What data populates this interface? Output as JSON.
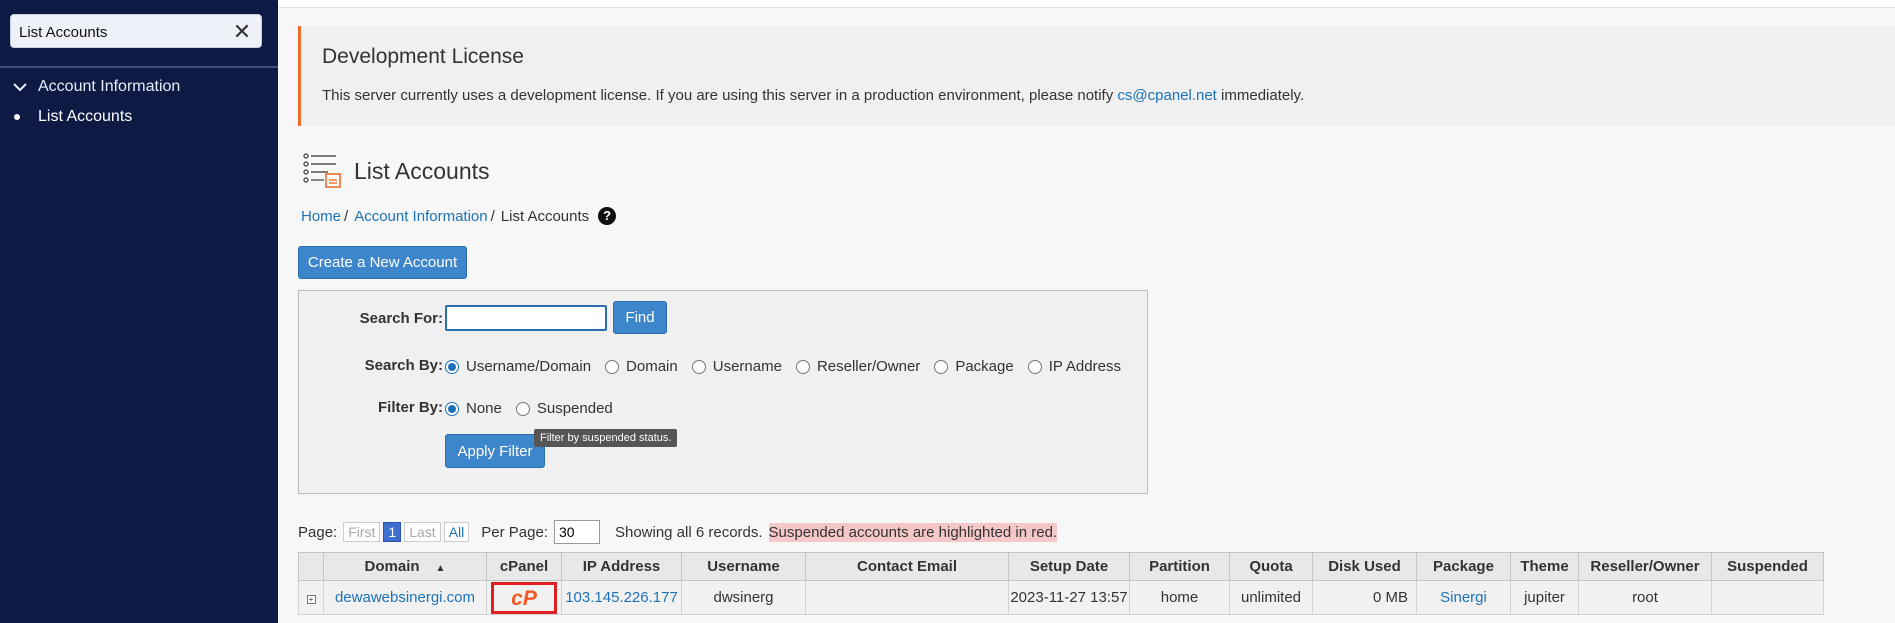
{
  "sidebar": {
    "search_value": "List Accounts",
    "group_label": "Account Information",
    "item_label": "List Accounts"
  },
  "notice": {
    "title": "Development License",
    "text_before": "This server currently uses a development license. If you are using this server in a production environment, please notify",
    "email": "cs@cpanel.net",
    "text_after": "immediately."
  },
  "page": {
    "title": "List Accounts",
    "breadcrumb": {
      "home": "Home",
      "section": "Account Information",
      "current": "List Accounts"
    },
    "create_button": "Create a New Account"
  },
  "filters": {
    "search_for_label": "Search For:",
    "search_value": "",
    "find_button": "Find",
    "search_by_label": "Search By:",
    "search_by_options": [
      "Username/Domain",
      "Domain",
      "Username",
      "Reseller/Owner",
      "Package",
      "IP Address"
    ],
    "search_by_selected": "Username/Domain",
    "filter_by_label": "Filter By:",
    "filter_by_options": [
      "None",
      "Suspended"
    ],
    "filter_by_selected": "None",
    "apply_button": "Apply Filter",
    "tooltip": "Filter by suspended status."
  },
  "pager": {
    "label": "Page:",
    "first": "First",
    "current": "1",
    "last": "Last",
    "all": "All",
    "per_page_label": "Per Page:",
    "per_page_value": "30",
    "showing": "Showing all 6 records.",
    "suspended_note": "Suspended accounts are highlighted in red."
  },
  "table": {
    "columns": [
      "Domain",
      "cPanel",
      "IP Address",
      "Username",
      "Contact Email",
      "Setup Date",
      "Partition",
      "Quota",
      "Disk Used",
      "Package",
      "Theme",
      "Reseller/Owner",
      "Suspended"
    ],
    "rows": [
      {
        "domain": "dewawebsinergi.com",
        "ip": "103.145.226.177",
        "username": "dwsinerg",
        "email": "",
        "setup_date": "2023-11-27 13:57",
        "partition": "home",
        "quota": "unlimited",
        "disk_used": "0 MB",
        "package": "Sinergi",
        "theme": "jupiter",
        "owner": "root",
        "suspended": ""
      }
    ]
  },
  "colors": {
    "sidebar": "#0c1a44",
    "accent": "#3d86cb",
    "link": "#1d72b8",
    "notice_border": "#ef6c2c",
    "cpanel_orange": "#ef5a24",
    "highlight_red": "#e02020"
  },
  "icons": {
    "clear": "close-icon",
    "group": "chevron-down-icon",
    "page": "list-accounts-icon",
    "help": "help-icon",
    "cpanel": "cpanel-logo-icon",
    "expand": "expand-icon"
  }
}
